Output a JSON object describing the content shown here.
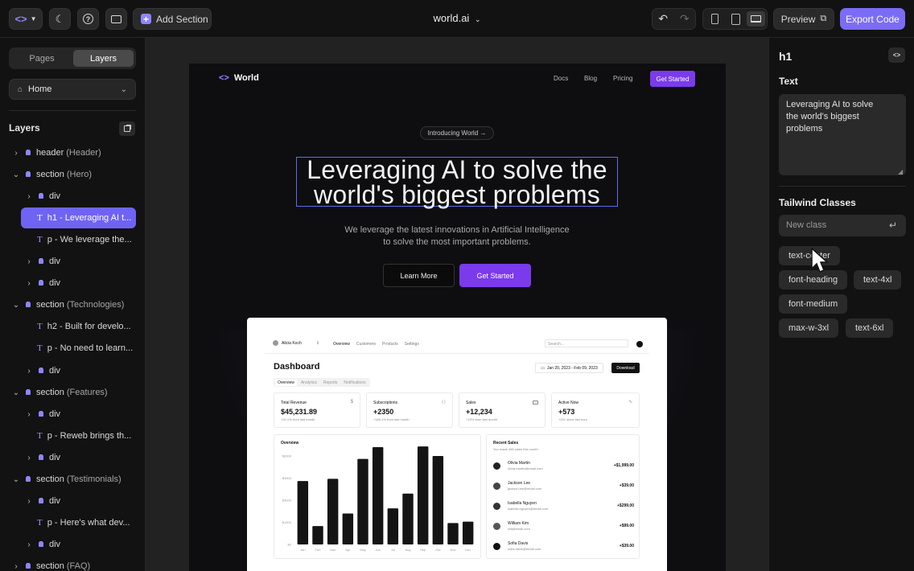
{
  "topbar": {
    "add_section_label": "Add Section",
    "title": "world.ai",
    "preview_label": "Preview",
    "export_label": "Export Code"
  },
  "left": {
    "tabs": [
      "Pages",
      "Layers"
    ],
    "page_select": "Home",
    "layers_title": "Layers",
    "layers": [
      {
        "name": "header",
        "muted": "(Header)"
      },
      {
        "name": "section",
        "muted": "(Hero)"
      },
      {
        "name": "div",
        "muted": ""
      },
      {
        "name": "h1 - Leveraging AI t...",
        "muted": ""
      },
      {
        "name": "p - We leverage the...",
        "muted": ""
      },
      {
        "name": "div",
        "muted": ""
      },
      {
        "name": "div",
        "muted": ""
      },
      {
        "name": "section",
        "muted": "(Technologies)"
      },
      {
        "name": "h2 - Built for develo...",
        "muted": ""
      },
      {
        "name": "p - No need to learn...",
        "muted": ""
      },
      {
        "name": "div",
        "muted": ""
      },
      {
        "name": "section",
        "muted": "(Features)"
      },
      {
        "name": "div",
        "muted": ""
      },
      {
        "name": "p - Reweb brings th...",
        "muted": ""
      },
      {
        "name": "div",
        "muted": ""
      },
      {
        "name": "section",
        "muted": "(Testimonials)"
      },
      {
        "name": "div",
        "muted": ""
      },
      {
        "name": "p - Here's what dev...",
        "muted": ""
      },
      {
        "name": "div",
        "muted": ""
      },
      {
        "name": "section",
        "muted": "(FAQ)"
      }
    ]
  },
  "site": {
    "brand": "World",
    "nav": [
      "Docs",
      "Blog",
      "Pricing"
    ],
    "cta": "Get Started",
    "pill": "Introducing World →",
    "headline_1": "Leveraging AI to solve the",
    "headline_2": "world's biggest problems",
    "sub_1": "We leverage the latest innovations in Artificial Intelligence",
    "sub_2": "to solve the most important problems.",
    "btn_learn": "Learn More",
    "btn_start": "Get Started"
  },
  "dash": {
    "user": "Alicia Koch",
    "nav": [
      "Overview",
      "Customers",
      "Products",
      "Settings"
    ],
    "search": "Search...",
    "title": "Dashboard",
    "date": "Jan 20, 2023 - Feb 09, 2023",
    "download": "Download",
    "tabs": [
      "Overview",
      "Analytics",
      "Reports",
      "Notifications"
    ],
    "cards": [
      {
        "label": "Total Revenue",
        "value": "$45,231.89",
        "sub": "+20.1% from last month",
        "icon": "$"
      },
      {
        "label": "Subscriptions",
        "value": "+2350",
        "sub": "+180.1% from last month",
        "icon": "users"
      },
      {
        "label": "Sales",
        "value": "+12,234",
        "sub": "+19% from last month",
        "icon": "card"
      },
      {
        "label": "Active Now",
        "value": "+573",
        "sub": "+201 since last hour",
        "icon": "pulse"
      }
    ],
    "overview": "Overview",
    "recent_title": "Recent Sales",
    "recent_sub": "You made 265 sales this month.",
    "sales": [
      {
        "name": "Olivia Martin",
        "email": "olivia.martin@email.com",
        "amount": "+$1,999.00"
      },
      {
        "name": "Jackson Lee",
        "email": "jackson.lee@email.com",
        "amount": "+$39.00"
      },
      {
        "name": "Isabella Nguyen",
        "email": "isabella.nguyen@email.com",
        "amount": "+$299.00"
      },
      {
        "name": "William Kim",
        "email": "will@email.com",
        "amount": "+$99.00"
      },
      {
        "name": "Sofia Davis",
        "email": "sofia.davis@email.com",
        "amount": "+$39.00"
      }
    ]
  },
  "chart_data": {
    "type": "bar",
    "categories": [
      "Jan",
      "Feb",
      "Mar",
      "Apr",
      "May",
      "Jun",
      "Jul",
      "Aug",
      "Sep",
      "Oct",
      "Nov",
      "Dec"
    ],
    "values": [
      4300,
      1250,
      4450,
      2100,
      5800,
      6600,
      2450,
      3450,
      6650,
      6000,
      1450,
      1550
    ],
    "yticks": [
      "$6000",
      "$4500",
      "$3000",
      "$1500",
      "$0"
    ],
    "ylim": [
      0,
      7000
    ],
    "title": "Overview"
  },
  "right": {
    "tag": "h1",
    "text_label": "Text",
    "text_value": "Leveraging AI to solve the world's biggest problems",
    "classes_label": "Tailwind Classes",
    "class_placeholder": "New class",
    "classes": [
      "text-center",
      "font-heading",
      "text-4xl",
      "font-medium",
      "max-w-3xl",
      "text-6xl"
    ]
  }
}
